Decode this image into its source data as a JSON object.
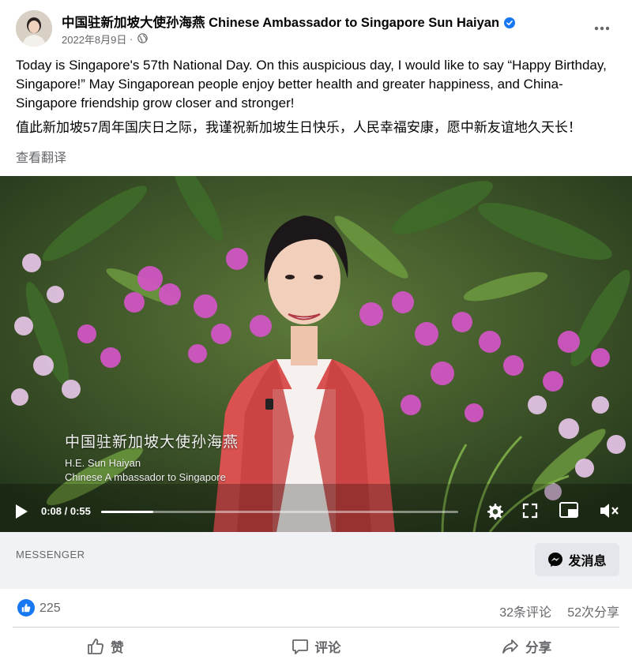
{
  "post": {
    "author": "中国驻新加坡大使孙海燕 Chinese Ambassador to Singapore Sun Haiyan",
    "date": "2022年8月9日",
    "date_separator": "·",
    "text_en": "Today is Singapore's 57th National Day. On this auspicious day, I would like to say “Happy Birthday, Singapore!” May Singaporean people enjoy better health and greater happiness, and China-Singapore friendship grow closer and stronger!",
    "text_zh": "值此新加坡57周年国庆日之际，我谨祝新加坡生日快乐，人民幸福安康，愿中新友谊地久天长！",
    "translate_link": "查看翻译"
  },
  "video": {
    "caption_zh": "中国驻新加坡大使孙海燕",
    "caption_en_line1": "H.E. Sun Haiyan",
    "caption_en_line2": "Chinese A mbassador to Singapore",
    "time": "0:08 / 0:55",
    "progress": 0.145
  },
  "messenger": {
    "label": "MESSENGER",
    "send_label": "发消息"
  },
  "stats": {
    "likes": "225",
    "comments": "32条评论",
    "shares": "52次分享"
  },
  "actions": {
    "like": "赞",
    "comment": "评论",
    "share": "分享"
  },
  "colors": {
    "accent": "#1877f2",
    "secondary_text": "#65676b",
    "bar_background": "#f0f2f5"
  },
  "icons": [
    "verified-badge-icon",
    "globe-icon",
    "more-icon",
    "play-icon",
    "settings-icon",
    "fullscreen-icon",
    "pip-icon",
    "mute-icon",
    "messenger-icon",
    "like-icon",
    "comment-icon",
    "share-icon"
  ]
}
